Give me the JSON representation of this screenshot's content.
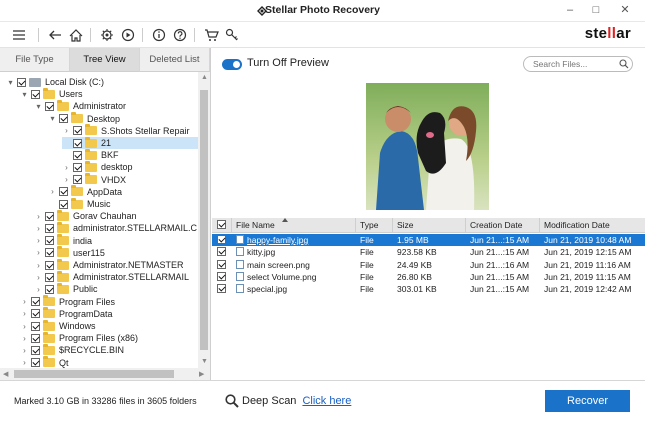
{
  "window": {
    "title": "Stellar Photo Recovery",
    "controls": [
      "minimize-icon",
      "maximize-icon",
      "close-icon"
    ]
  },
  "toolbar": {
    "icons": [
      "menu-icon",
      "back-icon",
      "home-icon",
      "settings-icon",
      "play-icon",
      "info-icon",
      "help-icon",
      "cart-icon",
      "key-icon"
    ],
    "brand": {
      "pre": "ste",
      "accent": "ll",
      "post": "ar"
    }
  },
  "tabs": [
    {
      "label": "File Type",
      "active": false
    },
    {
      "label": "Tree View",
      "active": true
    },
    {
      "label": "Deleted List",
      "active": false
    }
  ],
  "tree": [
    {
      "label": "Local Disk (C:)",
      "level": 0,
      "expand": "open",
      "icon": "drive"
    },
    {
      "label": "Users",
      "level": 1,
      "expand": "open",
      "icon": "folder"
    },
    {
      "label": "Administrator",
      "level": 2,
      "expand": "open",
      "icon": "folder"
    },
    {
      "label": "Desktop",
      "level": 3,
      "expand": "open",
      "icon": "folder"
    },
    {
      "label": "S.Shots Stellar Repair",
      "level": 4,
      "expand": "closed",
      "icon": "folder"
    },
    {
      "label": "21",
      "level": 4,
      "expand": "none",
      "icon": "folder",
      "selected": true
    },
    {
      "label": "BKF",
      "level": 4,
      "expand": "none",
      "icon": "folder"
    },
    {
      "label": "desktop",
      "level": 4,
      "expand": "closed",
      "icon": "folder"
    },
    {
      "label": "VHDX",
      "level": 4,
      "expand": "closed",
      "icon": "folder"
    },
    {
      "label": "AppData",
      "level": 3,
      "expand": "closed",
      "icon": "folder"
    },
    {
      "label": "Music",
      "level": 3,
      "expand": "none",
      "icon": "folder"
    },
    {
      "label": "Gorav Chauhan",
      "level": 2,
      "expand": "closed",
      "icon": "folder"
    },
    {
      "label": "administrator.STELLARMAIL.C",
      "level": 2,
      "expand": "closed",
      "icon": "folder"
    },
    {
      "label": "india",
      "level": 2,
      "expand": "closed",
      "icon": "folder"
    },
    {
      "label": "user115",
      "level": 2,
      "expand": "closed",
      "icon": "folder"
    },
    {
      "label": "Administrator.NETMASTER",
      "level": 2,
      "expand": "closed",
      "icon": "folder"
    },
    {
      "label": "Administrator.STELLARMAIL",
      "level": 2,
      "expand": "closed",
      "icon": "folder"
    },
    {
      "label": "Public",
      "level": 2,
      "expand": "closed",
      "icon": "folder"
    },
    {
      "label": "Program Files",
      "level": 1,
      "expand": "closed",
      "icon": "folder"
    },
    {
      "label": "ProgramData",
      "level": 1,
      "expand": "closed",
      "icon": "folder"
    },
    {
      "label": "Windows",
      "level": 1,
      "expand": "closed",
      "icon": "folder"
    },
    {
      "label": "Program Files (x86)",
      "level": 1,
      "expand": "closed",
      "icon": "folder"
    },
    {
      "label": "$RECYCLE.BIN",
      "level": 1,
      "expand": "closed",
      "icon": "folder"
    },
    {
      "label": "Qt",
      "level": 1,
      "expand": "closed",
      "icon": "folder"
    }
  ],
  "preview": {
    "toggle_label": "Turn Off Preview",
    "toggle_on": true,
    "search_placeholder": "Search Files..."
  },
  "grid": {
    "columns": [
      "File Name",
      "Type",
      "Size",
      "Creation Date",
      "Modification Date"
    ],
    "sort_column": "File Name",
    "rows": [
      {
        "name": "happy-family.jpg",
        "type": "File",
        "size": "1.95 MB",
        "created": "Jun 21...:15 AM",
        "modified": "Jun 21, 2019 10:48 AM",
        "selected": true
      },
      {
        "name": "kitty.jpg",
        "type": "File",
        "size": "923.58 KB",
        "created": "Jun 21...:15 AM",
        "modified": "Jun 21, 2019 12:15 AM",
        "selected": false
      },
      {
        "name": "main screen.png",
        "type": "File",
        "size": "24.49 KB",
        "created": "Jun 21...:16 AM",
        "modified": "Jun 21, 2019 11:16 AM",
        "selected": false
      },
      {
        "name": "select Volume.png",
        "type": "File",
        "size": "26.80 KB",
        "created": "Jun 21...:15 AM",
        "modified": "Jun 21, 2019 11:15 AM",
        "selected": false
      },
      {
        "name": "special.jpg",
        "type": "File",
        "size": "303.01 KB",
        "created": "Jun 21...:15 AM",
        "modified": "Jun 21, 2019 12:42 AM",
        "selected": false
      }
    ]
  },
  "footer": {
    "status": "Marked 3.10 GB in 33286 files in 3605 folders",
    "deep_scan_label": "Deep Scan",
    "deep_scan_link": "Click here",
    "recover_button": "Recover"
  },
  "colors": {
    "accent": "#1a73c9",
    "selection": "#1a78d2",
    "tree_selection": "#cce4f7",
    "folder": "#f2c94c",
    "brand_accent": "#dd2222"
  }
}
